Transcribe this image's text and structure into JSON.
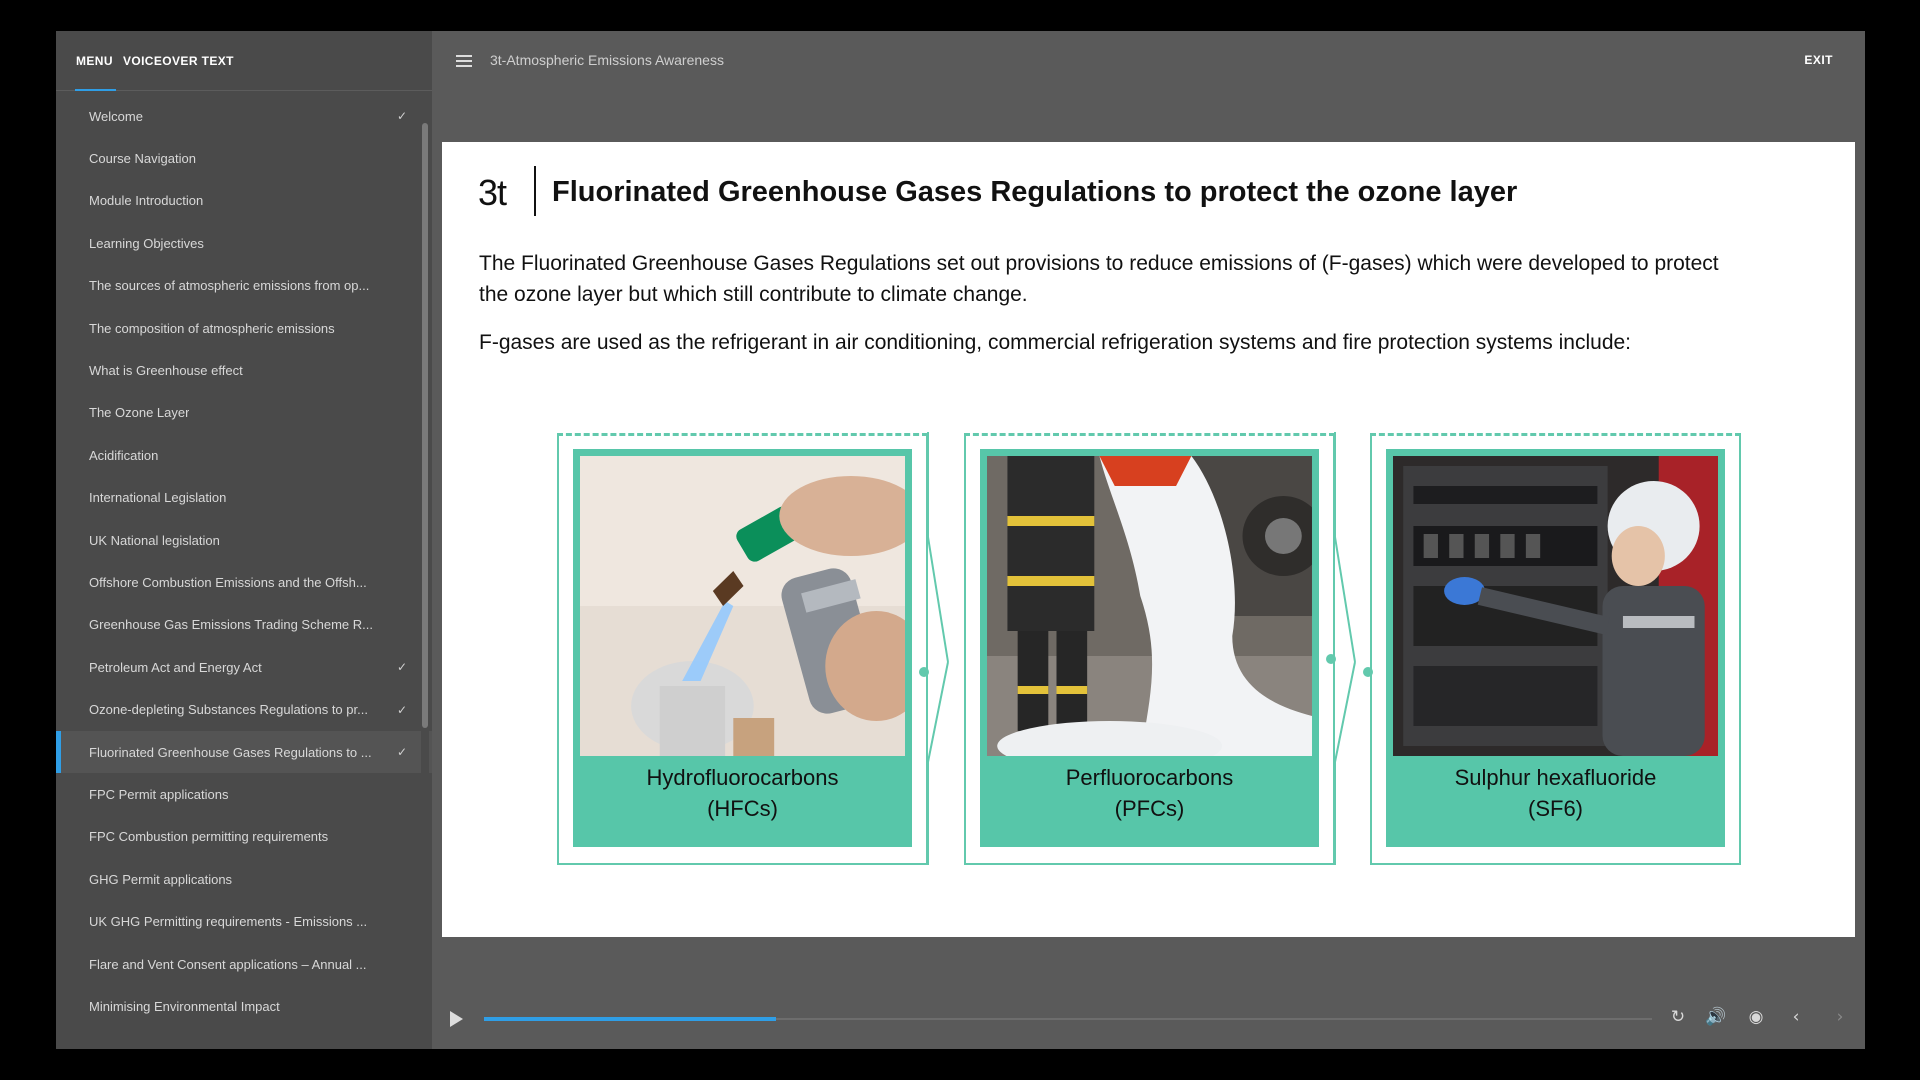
{
  "sidebar": {
    "tabs": [
      "MENU",
      "VOICEOVER TEXT"
    ],
    "items": [
      {
        "label": "Welcome",
        "done": true
      },
      {
        "label": "Course Navigation",
        "done": false
      },
      {
        "label": "Module Introduction",
        "done": false
      },
      {
        "label": "Learning Objectives",
        "done": false
      },
      {
        "label": "The sources of atmospheric emissions from op...",
        "done": false
      },
      {
        "label": "The composition of atmospheric emissions",
        "done": false
      },
      {
        "label": "What is Greenhouse effect",
        "done": false
      },
      {
        "label": "The Ozone Layer",
        "done": false
      },
      {
        "label": "Acidification",
        "done": false
      },
      {
        "label": "International Legislation",
        "done": false
      },
      {
        "label": "UK National legislation",
        "done": false
      },
      {
        "label": "Offshore Combustion Emissions and the Offsh...",
        "done": false
      },
      {
        "label": "Greenhouse Gas Emissions Trading Scheme R...",
        "done": false
      },
      {
        "label": "Petroleum Act and Energy Act",
        "done": true
      },
      {
        "label": "Ozone-depleting Substances Regulations to pr...",
        "done": true
      },
      {
        "label": "Fluorinated Greenhouse Gases Regulations to ...",
        "done": true,
        "active": true
      },
      {
        "label": "FPC Permit applications",
        "done": false
      },
      {
        "label": "FPC Combustion permitting requirements",
        "done": false
      },
      {
        "label": "GHG Permit applications",
        "done": false
      },
      {
        "label": "UK GHG Permitting requirements - Emissions ...",
        "done": false
      },
      {
        "label": "Flare and Vent Consent applications – Annual ...",
        "done": false
      },
      {
        "label": "Minimising Environmental Impact",
        "done": false
      }
    ],
    "check_glyph": "✓"
  },
  "topbar": {
    "course_title": "3t-Atmospheric Emissions Awareness",
    "exit_label": "EXIT"
  },
  "slide": {
    "logo": "3t",
    "title": "Fluorinated Greenhouse Gases Regulations to protect the ozone layer",
    "para1": "The Fluorinated Greenhouse Gases Regulations set out provisions to reduce emissions of (F-gases) which were developed to protect the ozone layer but which still contribute to climate change.",
    "para2": "F-gases are used as the refrigerant in air conditioning, commercial refrigeration systems and fire protection systems include:",
    "cards": [
      {
        "line1": "Hydrofluorocarbons",
        "line2": "(HFCs)",
        "photo": "blowtorch-photo"
      },
      {
        "line1": "Perfluorocarbons",
        "line2": "(PFCs)",
        "photo": "firefighter-foam-photo"
      },
      {
        "line1": "Sulphur hexafluoride",
        "line2": "(SF6)",
        "photo": "electrician-panel-photo"
      }
    ]
  },
  "player": {
    "progress": 0.25,
    "icons": [
      "play-icon",
      "replay-icon",
      "volume-icon",
      "captions-icon",
      "prev-icon",
      "next-icon"
    ]
  },
  "colors": {
    "accent": "#2f9ee6",
    "teal": "#57c6a9",
    "sidebar_bg": "#4a4a4a",
    "main_bg": "#5a5a5a"
  }
}
